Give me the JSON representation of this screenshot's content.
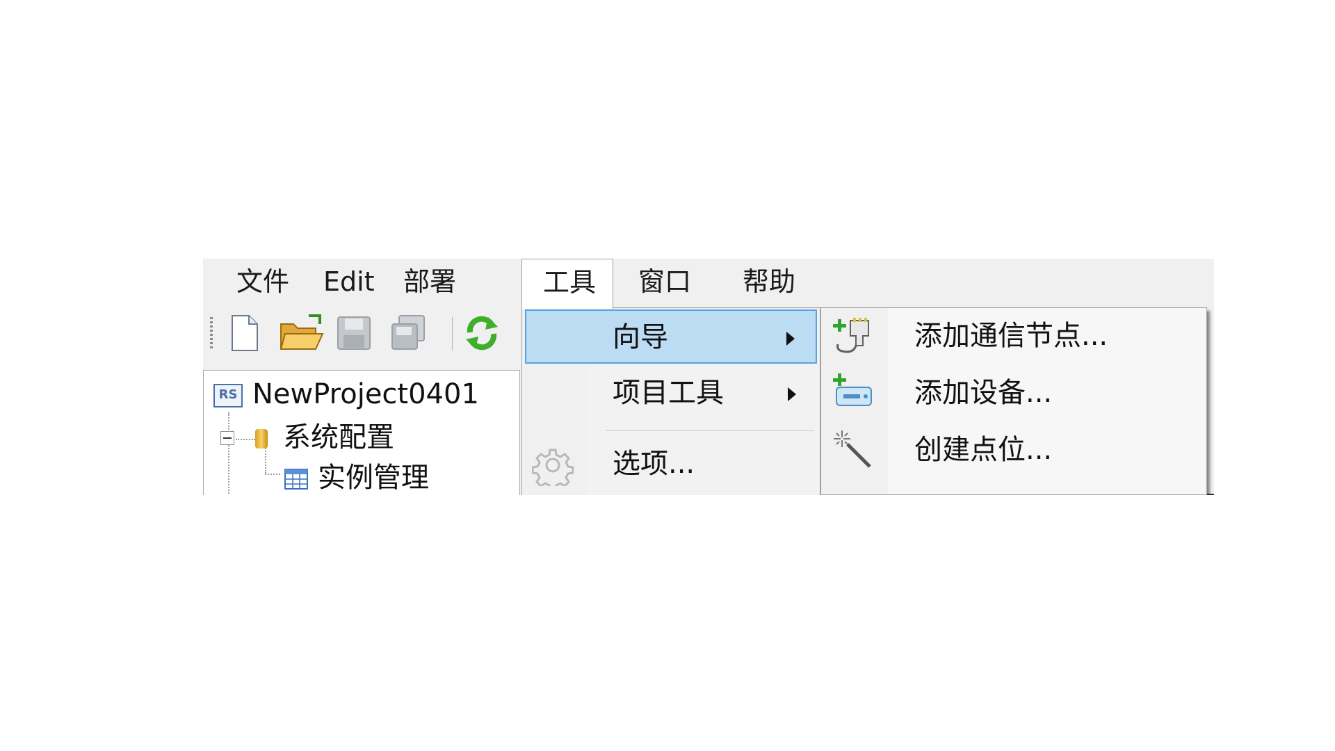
{
  "menubar": {
    "items": [
      "文件",
      "Edit",
      "部署",
      "工具",
      "窗口",
      "帮助"
    ]
  },
  "toolbar": {
    "icons": [
      "new-file-icon",
      "open-folder-icon",
      "save-icon",
      "save-all-icon",
      "refresh-icon"
    ]
  },
  "tree": {
    "project": {
      "badge": "RS",
      "label": "NewProject0401"
    },
    "system_config": "系统配置",
    "instance_mgmt": "实例管理"
  },
  "tools_menu": {
    "items": [
      {
        "label": "向导"
      },
      {
        "label": "项目工具"
      },
      {
        "label": "选项..."
      }
    ]
  },
  "wizard_submenu": {
    "items": [
      {
        "label": "添加通信节点..."
      },
      {
        "label": "添加设备..."
      },
      {
        "label": "创建点位..."
      }
    ]
  },
  "colors": {
    "highlight_bg": "#bcdcf4",
    "highlight_border": "#5aa3e0",
    "menubar_bg": "#f0f0f0"
  }
}
